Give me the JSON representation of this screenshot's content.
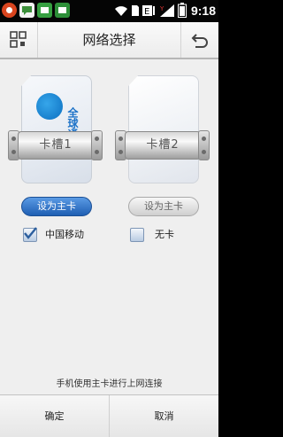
{
  "status_bar": {
    "time": "9:18",
    "icons": [
      "notification-app-icon",
      "sms-icon",
      "cmcc-store-icon",
      "cmcc-store-icon",
      "wifi-icon",
      "sim-icon",
      "data-signal-icon",
      "signal-icon",
      "battery-icon"
    ],
    "accent": "#36a041"
  },
  "header": {
    "title": "网络选择"
  },
  "cards": [
    {
      "name": "sim-card-1",
      "slot_label": "卡槽1",
      "brand_text": "全球通",
      "set_primary_label": "设为主卡",
      "is_primary": true,
      "operator_label": "中国移动",
      "checked": true
    },
    {
      "name": "sim-card-2",
      "slot_label": "卡槽2",
      "brand_text": "",
      "set_primary_label": "设为主卡",
      "is_primary": false,
      "operator_label": "无卡",
      "checked": false
    }
  ],
  "hint": "手机使用主卡进行上网连接",
  "footer": {
    "confirm_label": "确定",
    "cancel_label": "取消"
  },
  "colors": {
    "primary_button": "#2f6fc4",
    "background": "#efefef"
  }
}
